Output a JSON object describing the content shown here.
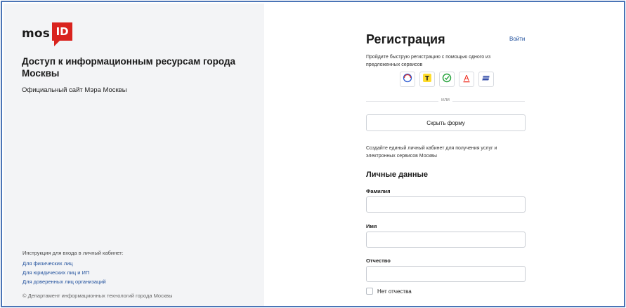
{
  "brand": {
    "logo_text": "mos",
    "logo_badge": "ID",
    "accent_color": "#d9231e",
    "link_color": "#1f4f9c"
  },
  "left_panel": {
    "title": "Доступ к информационным ресурсам города Москвы",
    "subtitle": "Официальный сайт Мэра Москвы",
    "instructions_heading": "Инструкция для входа в личный кабинет:",
    "links": [
      "Для физических лиц",
      "Для юридических лиц и ИП",
      "Для доверенных лиц организаций"
    ],
    "copyright": "© Департамент информационных технологий города Москвы"
  },
  "registration": {
    "title": "Регистрация",
    "login_link": "Войти",
    "quick_text": "Пройдите быструю регистрацию с помощью одного из предложенных сервисов",
    "services": [
      {
        "icon": "gosuslugi-icon",
        "label": ""
      },
      {
        "icon": "tbank-icon",
        "label": "Т"
      },
      {
        "icon": "sber-icon",
        "label": ""
      },
      {
        "icon": "alfa-icon",
        "label": "А"
      },
      {
        "icon": "vtb-icon",
        "label": ""
      }
    ],
    "divider_text": "или",
    "hide_form_button": "Скрыть форму",
    "create_text": "Создайте единый личный кабинет для получения услуг и электронных сервисов Москвы",
    "personal_section_title": "Личные данные",
    "fields": {
      "last_name": {
        "label": "Фамилия",
        "value": "",
        "placeholder": ""
      },
      "first_name": {
        "label": "Имя",
        "value": "",
        "placeholder": ""
      },
      "patronymic": {
        "label": "Отчество",
        "value": "",
        "placeholder": ""
      }
    },
    "no_patronymic_label": "Нет отчества",
    "no_patronymic_checked": false
  }
}
